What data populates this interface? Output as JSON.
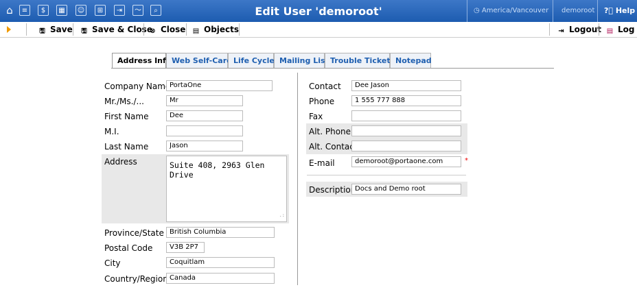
{
  "title": "Edit User 'demoroot'",
  "header": {
    "icons": [
      "home-icon",
      "list-icon",
      "dollar-icon",
      "grid-icon",
      "person-icon",
      "network-icon",
      "import-icon",
      "chart-icon",
      "search-icon"
    ],
    "timezone": "America/Vancouver",
    "user": "demoroot",
    "help": "Help"
  },
  "toolbar": {
    "save": "Save",
    "save_close": "Save & Close",
    "close": "Close",
    "objects": "Objects",
    "logout": "Logout",
    "log": "Log"
  },
  "tabs": [
    "Address Info",
    "Web Self-Care",
    "Life Cycle",
    "Mailing List",
    "Trouble Tickets",
    "Notepad"
  ],
  "left": {
    "company_label": "Company Name",
    "company": "PortaOne",
    "title_label": "Mr./Ms./...",
    "title_val": "Mr",
    "first_label": "First Name",
    "first": "Dee",
    "mi_label": "M.I.",
    "mi": "",
    "last_label": "Last Name",
    "last": "Jason",
    "address_label": "Address",
    "address": "Suite 408, 2963 Glen Drive",
    "province_label": "Province/State",
    "province": "British Columbia",
    "postal_label": "Postal Code",
    "postal": "V3B 2P7",
    "city_label": "City",
    "city": "Coquitlam",
    "country_label": "Country/Region",
    "country": "Canada"
  },
  "right": {
    "contact_label": "Contact",
    "contact": "Dee Jason",
    "phone_label": "Phone",
    "phone": "1 555 777 888",
    "fax_label": "Fax",
    "fax": "",
    "altphone_label": "Alt. Phone",
    "altphone": "",
    "altcontact_label": "Alt. Contact",
    "altcontact": "",
    "email_label": "E-mail",
    "email": "demoroot@portaone.com",
    "required_mark": "*",
    "desc_label": "Description",
    "desc": "Docs and Demo root"
  }
}
